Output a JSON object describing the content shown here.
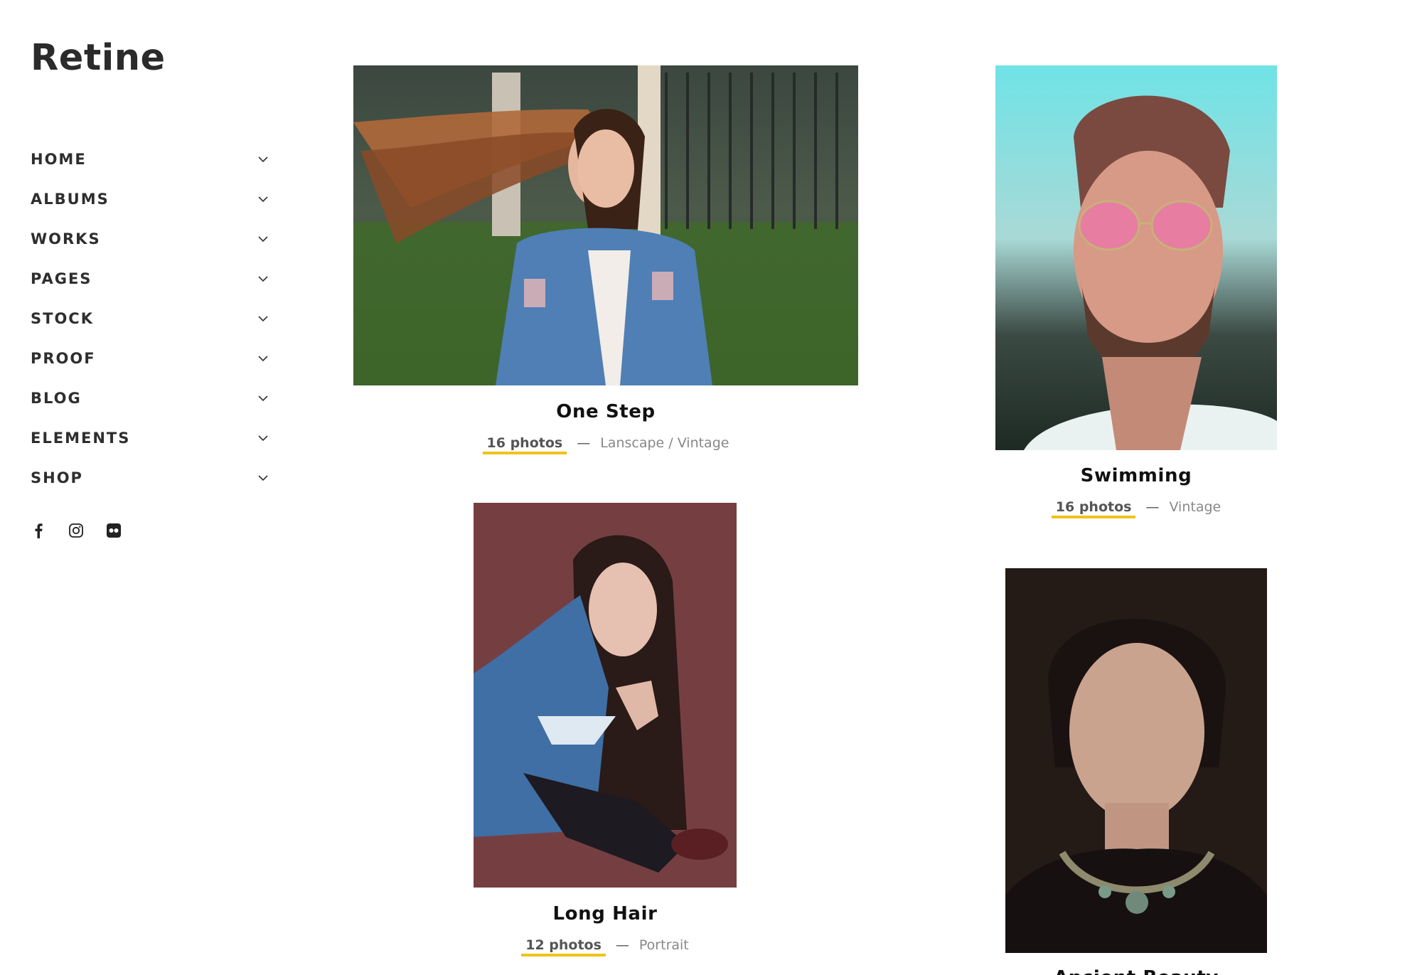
{
  "site": {
    "logo": "Retine"
  },
  "nav": {
    "items": [
      {
        "label": "HOME"
      },
      {
        "label": "ALBUMS"
      },
      {
        "label": "WORKS"
      },
      {
        "label": "PAGES"
      },
      {
        "label": "STOCK"
      },
      {
        "label": "PROOF"
      },
      {
        "label": "BLOG"
      },
      {
        "label": "ELEMENTS"
      },
      {
        "label": "SHOP"
      }
    ]
  },
  "social": [
    "facebook-icon",
    "instagram-icon",
    "flickr-icon"
  ],
  "albums": [
    {
      "title": "One Step",
      "count": "16 photos",
      "separator": "—",
      "categories": "Lanscape / Vintage"
    },
    {
      "title": "Swimming",
      "count": "16 photos",
      "separator": "—",
      "categories": "Vintage"
    },
    {
      "title": "Long Hair",
      "count": "12 photos",
      "separator": "—",
      "categories": "Portrait"
    },
    {
      "title": "Ancient Beauty"
    }
  ],
  "colors": {
    "accent": "#f0c419",
    "text": "#2e2e2e",
    "muted": "#888888"
  }
}
